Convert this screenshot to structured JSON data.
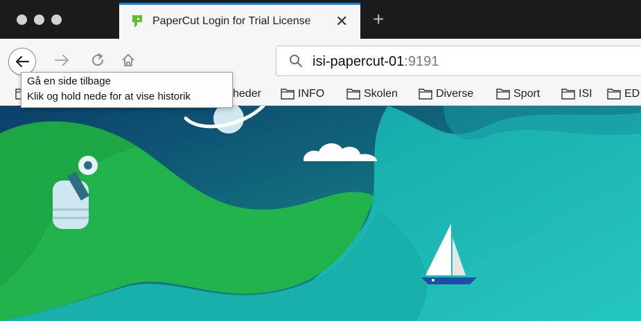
{
  "window": {
    "buttons": [
      "close",
      "minimize",
      "zoom"
    ]
  },
  "tabs": [
    {
      "title": "PaperCut Login for Trial License",
      "icon": "papercut-logo-icon",
      "active": true,
      "close_label": "✕"
    }
  ],
  "new_tab_label": "+",
  "nav": {
    "back_icon": "back-arrow-icon",
    "forward_icon": "forward-arrow-icon",
    "reload_icon": "reload-icon",
    "home_icon": "home-icon"
  },
  "urlbar": {
    "host": "isi-papercut-01",
    "port": ":9191",
    "search_icon": "search-icon"
  },
  "bookmarks": [
    {
      "label": "heder",
      "icon": "folder-icon"
    },
    {
      "label": "INFO",
      "icon": "folder-icon"
    },
    {
      "label": "Skolen",
      "icon": "folder-icon"
    },
    {
      "label": "Diverse",
      "icon": "folder-icon"
    },
    {
      "label": "Sport",
      "icon": "folder-icon"
    },
    {
      "label": "ISI",
      "icon": "folder-icon"
    },
    {
      "label": "ED",
      "icon": "folder-icon"
    }
  ],
  "tooltip": {
    "line1": "Gå en side tilbage",
    "line2": "Klik og hold nede for at vise historik"
  },
  "colors": {
    "tab_accent": "#0a84ff",
    "chrome_dark": "#1b1b1d",
    "toolbar": "#f6f6f6",
    "sea": "#1fb8b4",
    "hill_green": "#22b24c",
    "sky": "#0e4f7a"
  }
}
